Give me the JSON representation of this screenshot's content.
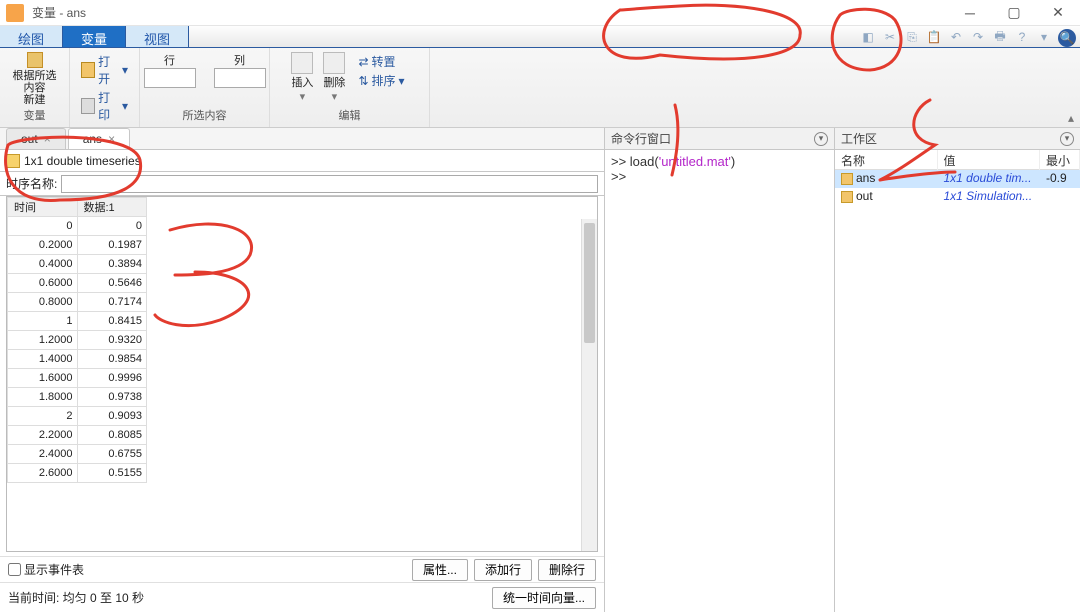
{
  "window": {
    "title": "变量 - ans"
  },
  "main_tabs": {
    "plot": "绘图",
    "variable": "变量",
    "view": "视图"
  },
  "ribbon": {
    "new_from_sel1": "根据所选内容",
    "new_from_sel2": "新建",
    "open": "打开",
    "print": "打印",
    "row": "行",
    "col": "列",
    "insert": "插入",
    "delete": "删除",
    "transpose": "转置",
    "sort": "排序",
    "group_var": "变量",
    "group_sel": "所选内容",
    "group_edit": "编辑"
  },
  "var_tabs": {
    "out": "out",
    "ans": "ans"
  },
  "var_type": "1x1 double timeseries",
  "seq_name_label": "时序名称:",
  "table": {
    "time_hdr": "时间",
    "data_hdr": "数据:1",
    "rows": [
      {
        "t": "0",
        "v": "0"
      },
      {
        "t": "0.2000",
        "v": "0.1987"
      },
      {
        "t": "0.4000",
        "v": "0.3894"
      },
      {
        "t": "0.6000",
        "v": "0.5646"
      },
      {
        "t": "0.8000",
        "v": "0.7174"
      },
      {
        "t": "1",
        "v": "0.8415"
      },
      {
        "t": "1.2000",
        "v": "0.9320"
      },
      {
        "t": "1.4000",
        "v": "0.9854"
      },
      {
        "t": "1.6000",
        "v": "0.9996"
      },
      {
        "t": "1.8000",
        "v": "0.9738"
      },
      {
        "t": "2",
        "v": "0.9093"
      },
      {
        "t": "2.2000",
        "v": "0.8085"
      },
      {
        "t": "2.4000",
        "v": "0.6755"
      },
      {
        "t": "2.6000",
        "v": "0.5155"
      }
    ]
  },
  "show_events": "显示事件表",
  "btn_props": "属性...",
  "btn_addrow": "添加行",
  "btn_delrow": "删除行",
  "current_time": "当前时间: 均匀 0 至 10 秒",
  "btn_uniform": "统一时间向量...",
  "cmd": {
    "title": "命令行窗口",
    "line1_prompt": ">> ",
    "line1_fn": "load(",
    "line1_str": "'untitled.mat'",
    "line1_end": ")",
    "line2_prompt": ">> "
  },
  "workspace": {
    "title": "工作区",
    "col_name": "名称",
    "col_value": "值",
    "col_min": "最小",
    "rows": [
      {
        "name": "ans",
        "value": "1x1 double tim...",
        "min": "-0.9",
        "sel": true
      },
      {
        "name": "out",
        "value": "1x1 Simulation...",
        "min": "",
        "sel": false
      }
    ]
  }
}
